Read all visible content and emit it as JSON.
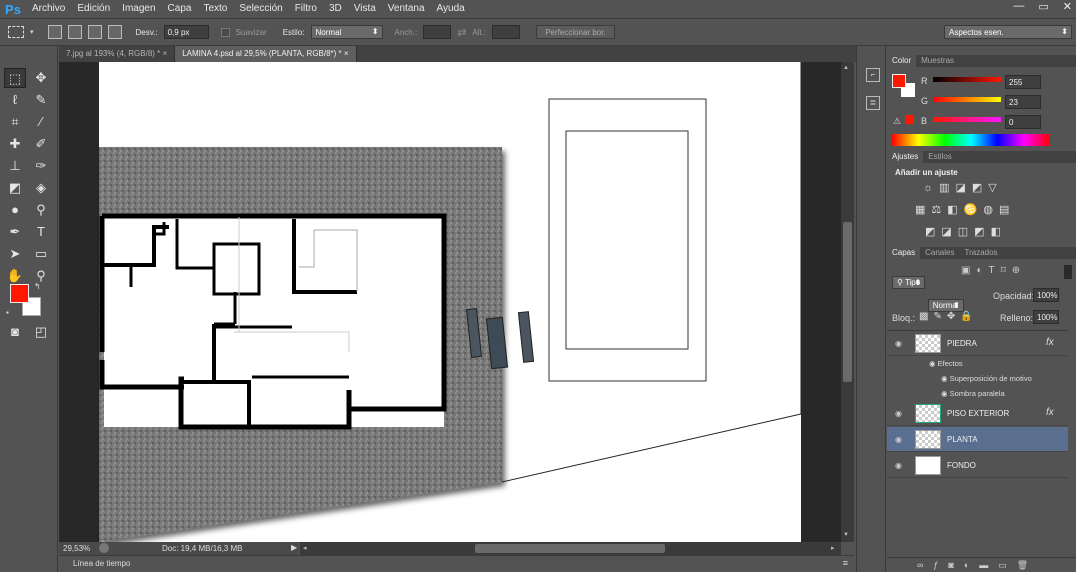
{
  "menubar": {
    "logo": "Ps",
    "items": [
      "Archivo",
      "Edición",
      "Imagen",
      "Capa",
      "Texto",
      "Selección",
      "Filtro",
      "3D",
      "Vista",
      "Ventana",
      "Ayuda"
    ],
    "controls": [
      "—",
      "▭",
      "✕"
    ]
  },
  "options": {
    "desv_label": "Desv.:",
    "desv_value": "0,9 px",
    "suavizar": "Suavizar",
    "estilo_label": "Estilo:",
    "estilo_value": "Normal",
    "anch_label": "Anch.:",
    "alt_label": "Alt.:",
    "refine_button": "Perfeccionar bor.",
    "workspace": "Aspectos esen."
  },
  "tabs": [
    {
      "label": "7.jpg al 193% (4, RGB/8) *",
      "close": "×"
    },
    {
      "label": "LAMINA 4.psd al 29,5% (PLANTA, RGB/8*) *",
      "close": "×"
    }
  ],
  "status": {
    "zoom": "29,53%",
    "doc": "Doc: 19,4 MB/16,3 MB"
  },
  "timeline": {
    "label": "Línea de tiempo"
  },
  "color_panel": {
    "tabs": [
      "Color",
      "Muestras"
    ],
    "r_label": "R",
    "g_label": "G",
    "b_label": "B",
    "r": "255",
    "g": "23",
    "b": "0",
    "foreground": "#ff1700"
  },
  "adjust_panel": {
    "tabs": [
      "Ajustes",
      "Estilos"
    ],
    "heading": "Añadir un ajuste"
  },
  "layers_panel": {
    "tabs": [
      "Capas",
      "Canales",
      "Trazados"
    ],
    "filter": "Tipo",
    "blend": "Normal",
    "opacity_label": "Opacidad:",
    "opacity": "100%",
    "lock_label": "Bloq.:",
    "fill_label": "Relleno:",
    "fill": "100%",
    "layers": [
      {
        "name": "PIEDRA",
        "fx": "fx"
      },
      {
        "name": "PISO EXTERIOR",
        "fx": "fx"
      },
      {
        "name": "PLANTA",
        "fx": ""
      },
      {
        "name": "FONDO",
        "fx": ""
      }
    ],
    "effects_label": "Efectos",
    "effects": [
      "Superposición de motivo",
      "Sombra paralela"
    ]
  }
}
